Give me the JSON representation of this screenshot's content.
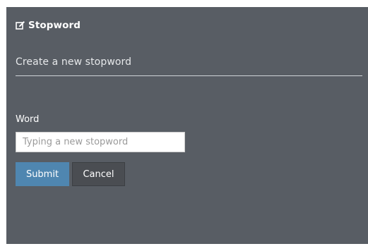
{
  "panel": {
    "title": "Stopword",
    "title_icon": "edit-icon"
  },
  "form": {
    "heading": "Create a new stopword",
    "word_label": "Word",
    "word_value": "",
    "word_placeholder": "Typing a new stopword",
    "submit_label": "Submit",
    "cancel_label": "Cancel"
  },
  "colors": {
    "panel_background": "#585d64",
    "submit_button": "#4f86b0",
    "cancel_button": "#4a4d52"
  }
}
